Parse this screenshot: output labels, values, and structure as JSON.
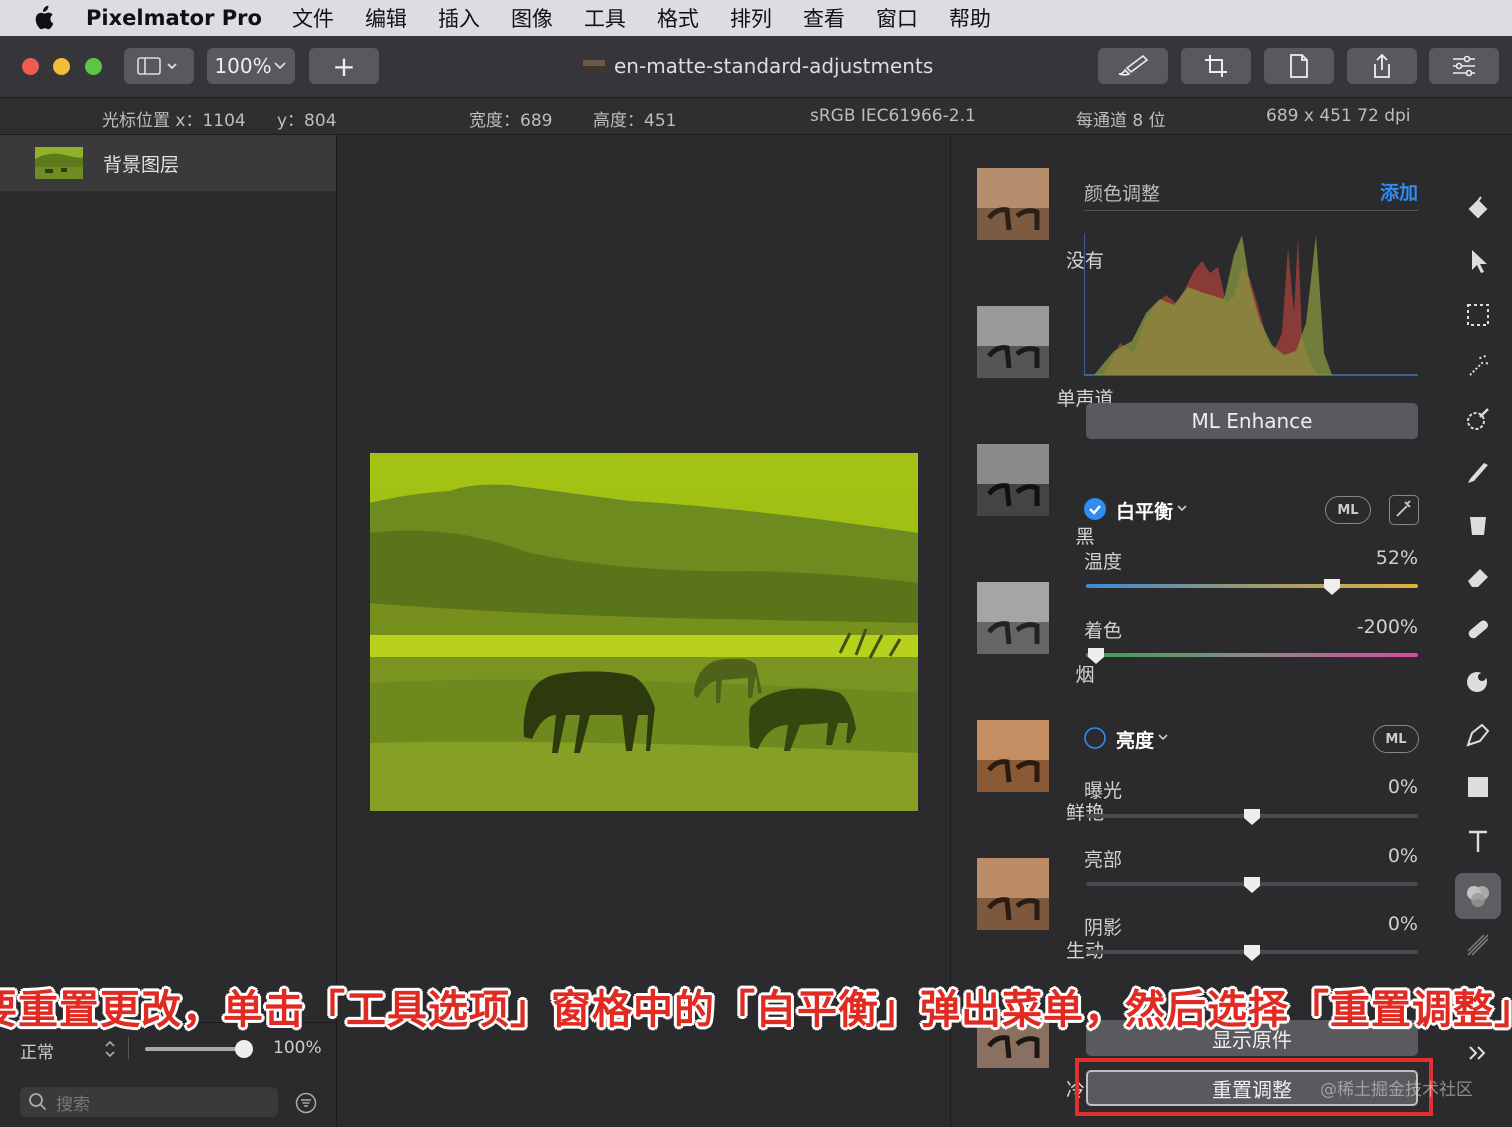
{
  "menubar": {
    "app": "Pixelmator Pro",
    "items": [
      "文件",
      "编辑",
      "插入",
      "图像",
      "工具",
      "格式",
      "排列",
      "查看",
      "窗口",
      "帮助"
    ]
  },
  "toolbar": {
    "zoom": "100%",
    "add": "+",
    "doc_title": "en-matte-standard-adjustments"
  },
  "infobar": {
    "cursor": "光标位置 x：1104",
    "y": "y：804",
    "width": "宽度：689",
    "height": "高度：451",
    "profile": "sRGB IEC61966-2.1",
    "depth": "每通道 8 位",
    "size": "689 x 451 72 dpi"
  },
  "layers": {
    "items": [
      {
        "name": "背景图层"
      }
    ],
    "blend_mode": "正常",
    "opacity": "100%",
    "search_placeholder": "搜索"
  },
  "presets": [
    "没有",
    "单声道",
    "黑",
    "烟",
    "鲜艳",
    "生动",
    "冷静"
  ],
  "adjustments": {
    "header": "颜色调整",
    "add": "添加",
    "ml_enhance": "ML Enhance",
    "white_balance": {
      "label": "白平衡",
      "enabled": true,
      "ml": "ML",
      "temperature": {
        "label": "温度",
        "value": "52%",
        "level": 0.74
      },
      "tint": {
        "label": "着色",
        "value": "-200%",
        "level": 0.03
      }
    },
    "lightness": {
      "label": "亮度",
      "enabled": false,
      "ml": "ML",
      "exposure": {
        "label": "曝光",
        "value": "0%",
        "level": 0.5
      },
      "highlights": {
        "label": "亮部",
        "value": "0%",
        "level": 0.5
      },
      "shadows": {
        "label": "阴影",
        "value": "0%",
        "level": 0.5
      }
    },
    "show_original": "显示原件",
    "reset": "重置调整"
  },
  "caption": "要重置更改，单击「工具选项」窗格中的「白平衡」弹出菜单，然后选择「重置调整」",
  "watermark": "@稀土掘金技术社区"
}
